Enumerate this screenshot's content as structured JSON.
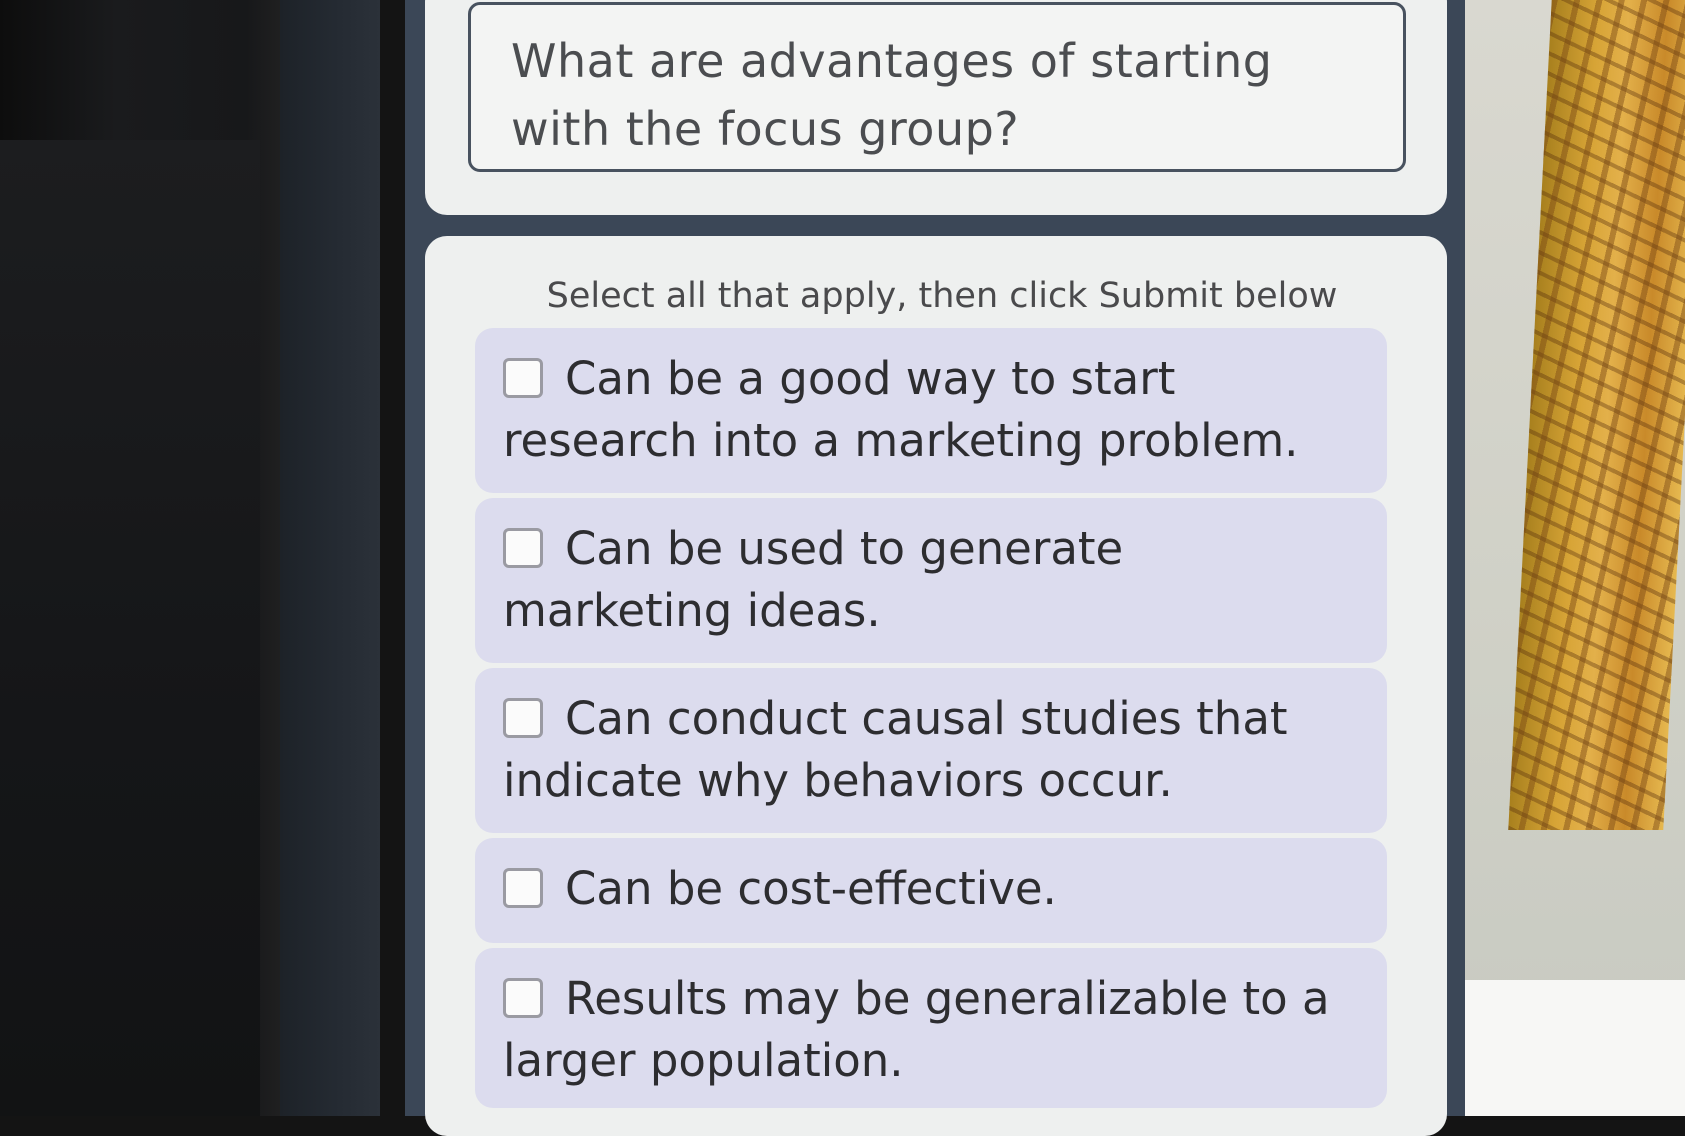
{
  "question": {
    "text": "What are advantages of starting with the focus group?"
  },
  "instructions": "Select all that apply, then click Submit below",
  "options": [
    {
      "label": "Can be a good way to start research into a marketing problem.",
      "checked": false
    },
    {
      "label": "Can be used to generate marketing ideas.",
      "checked": false
    },
    {
      "label": "Can conduct causal studies that indicate why behaviors occur.",
      "checked": false
    },
    {
      "label": "Can be cost-effective.",
      "checked": false
    },
    {
      "label": "Results may be generalizable to a larger population.",
      "checked": false
    }
  ],
  "colors": {
    "option_background": "#dcdcee",
    "card_background": "#eef0ef",
    "frame": "#3b4757",
    "text": "#2d2d30"
  }
}
